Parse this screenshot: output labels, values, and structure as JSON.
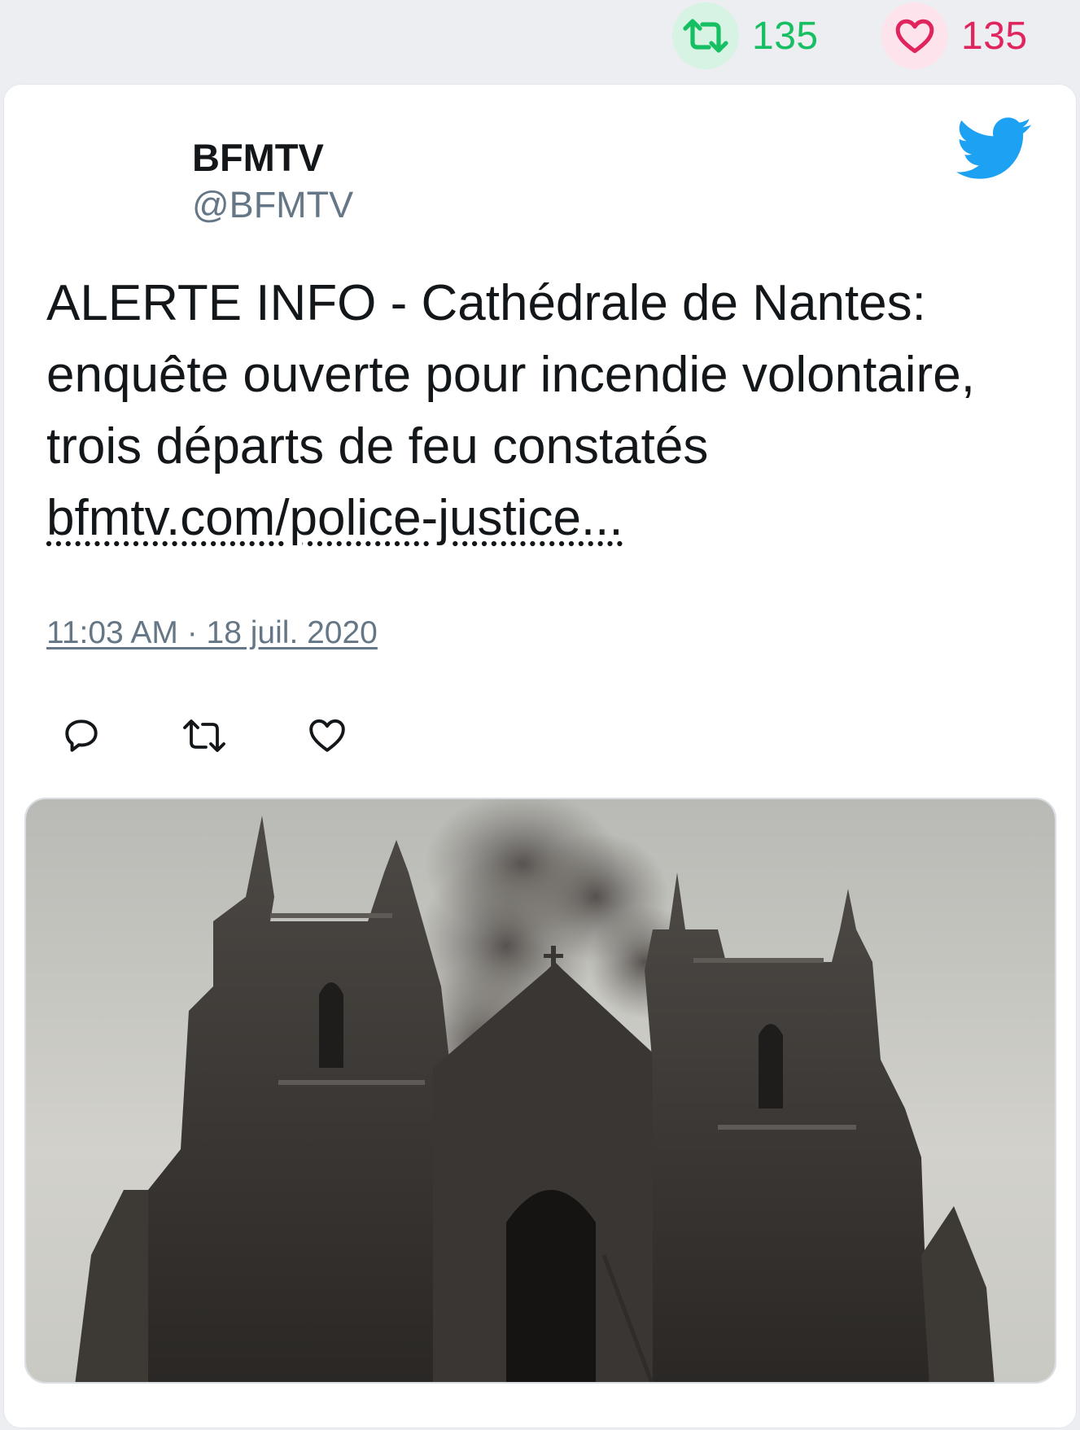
{
  "stats": {
    "retweets": "135",
    "likes": "135",
    "retweet_icon": "retweet-icon",
    "like_icon": "heart-icon",
    "retweet_color": "#17bf63",
    "like_color": "#e0245e"
  },
  "tweet": {
    "display_name": "BFMTV",
    "handle": "@BFMTV",
    "text": "ALERTE INFO - Cathédrale de Nantes: enquête ouverte pour incendie volontaire, trois départs de feu constatés",
    "link": "bfmtv.com/police-justice...",
    "timestamp": "11:03 AM · 18 juil. 2020",
    "brand_icon": "twitter-bird-icon",
    "brand_color": "#1da1f2",
    "actions": [
      "reply-icon",
      "retweet-icon",
      "heart-icon"
    ]
  }
}
